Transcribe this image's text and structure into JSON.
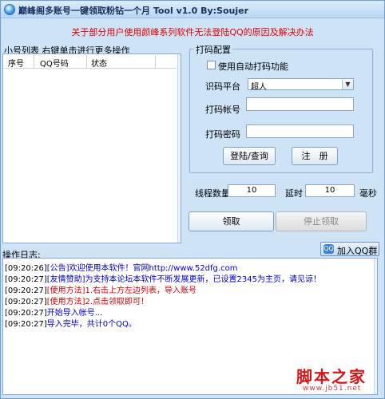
{
  "window": {
    "title": "巅峰阁多账号一键领取粉钻一个月 Tool v1.0 By:Soujer"
  },
  "banner": {
    "text": "关于部分用户使用颜峰系列软件无法登陆QQ的原因及解决办法",
    "color": "#e00000"
  },
  "account_list": {
    "caption": "小号列表    右键单击进行更多操作",
    "columns": [
      "序号",
      "QQ号码",
      "状态"
    ],
    "rows": []
  },
  "captcha_settings": {
    "title": "打码配置",
    "auto_captcha_label": "使用自动打码功能",
    "auto_captcha_checked": false,
    "platform_label": "识码平台",
    "platform_value": "超人",
    "account_label": "打码帐号",
    "account_value": "",
    "password_label": "打码密码",
    "password_value": "",
    "login_button": "登陆/查询",
    "register_button": "注　册"
  },
  "threading": {
    "threads_label": "线程数量",
    "threads_value": "10",
    "delay_label": "延时",
    "delay_value": "10",
    "delay_unit": "毫秒"
  },
  "actions": {
    "claim_button": "领取",
    "stop_button": "停止领取",
    "stop_disabled": true
  },
  "log": {
    "caption": "操作日志:",
    "qq_group_button": "加入QQ群",
    "qq_icon": "qq-group-icon",
    "lines": [
      {
        "time": "[09:20:26]",
        "text": "[公告]欢迎使用本软件！官网http://www.52dfg.com",
        "color": "#0000c0"
      },
      {
        "time": "[09:20:27]",
        "text": "[友情赞助]为支持本论坛本软件不断发展更新，已设置2345为主页，请见谅！",
        "color": "#0000c0"
      },
      {
        "time": "[09:20:27]",
        "text": "[使用方法]1.右击上方左边列表，导入账号",
        "color": "#d00000"
      },
      {
        "time": "[09:20:27]",
        "text": "[使用方法]2.点击领取即可！",
        "color": "#d00000"
      },
      {
        "time": "[09:20:27]",
        "text": "开始导入帐号...",
        "color": "#0000c0"
      },
      {
        "time": "[09:20:27]",
        "text": "导入完毕，共计0个QQ。",
        "color": "#0000c0"
      }
    ]
  },
  "watermark": {
    "main": "脚本之家",
    "sub": "www.jb51.net"
  }
}
